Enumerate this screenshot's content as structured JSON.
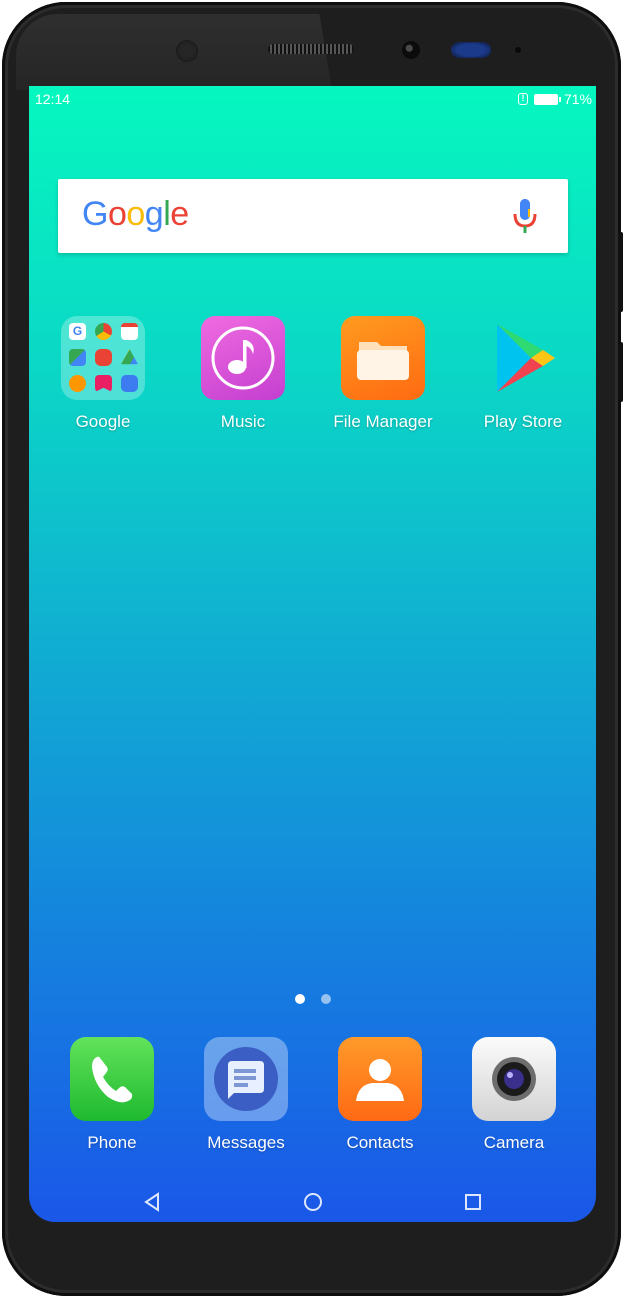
{
  "status_bar": {
    "time": "12:14",
    "battery_percent": "71%"
  },
  "search": {
    "logo_letters": [
      "G",
      "o",
      "o",
      "g",
      "l",
      "e"
    ],
    "logo_colors": [
      "#4285F4",
      "#EA4335",
      "#FBBC05",
      "#4285F4",
      "#34A853",
      "#EA4335"
    ],
    "mic_icon": "mic-icon"
  },
  "apps": [
    {
      "label": "Google",
      "icon": "google-folder-icon"
    },
    {
      "label": "Music",
      "icon": "music-note-icon"
    },
    {
      "label": "File Manager",
      "icon": "folder-icon"
    },
    {
      "label": "Play Store",
      "icon": "play-store-icon"
    }
  ],
  "pager": {
    "pages": 2,
    "current": 1
  },
  "dock": [
    {
      "label": "Phone",
      "icon": "phone-handset-icon"
    },
    {
      "label": "Messages",
      "icon": "message-bubble-icon"
    },
    {
      "label": "Contacts",
      "icon": "contact-person-icon"
    },
    {
      "label": "Camera",
      "icon": "camera-lens-icon"
    }
  ],
  "nav": {
    "back_icon": "back-triangle-icon",
    "home_icon": "home-circle-icon",
    "recents_icon": "recents-square-icon"
  },
  "colors": {
    "wallpaper_top": "#06f7bf",
    "wallpaper_bottom": "#1a57e8",
    "phone_body": "#1e1e1e"
  }
}
